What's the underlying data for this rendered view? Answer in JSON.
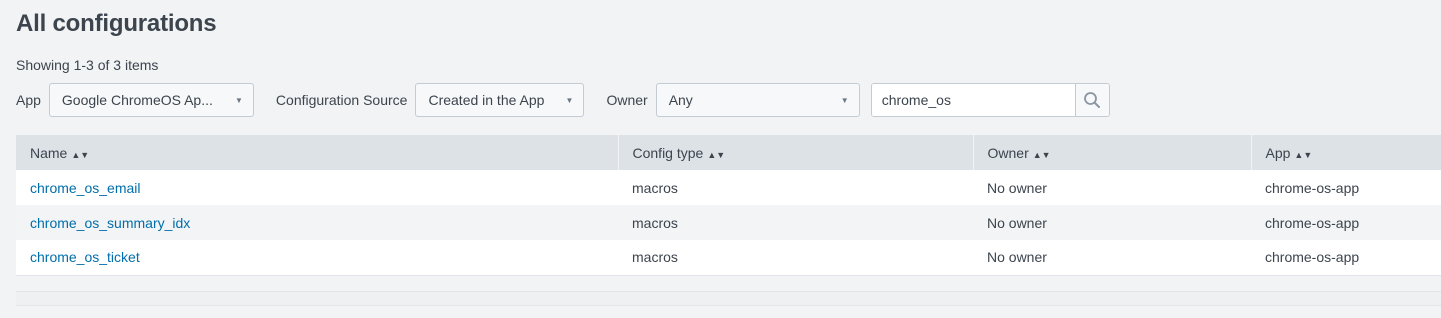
{
  "page": {
    "title": "All configurations",
    "count_text": "Showing 1-3 of 3 items"
  },
  "filters": {
    "app_label": "App",
    "app_value": "Google ChromeOS Ap...",
    "source_label": "Configuration Source",
    "source_value": "Created in the App",
    "owner_label": "Owner",
    "owner_value": "Any",
    "search_value": "chrome_os",
    "caret_icon": "caret-down-icon",
    "search_icon": "search-icon"
  },
  "table": {
    "columns": [
      "Name",
      "Config type",
      "Owner",
      "App"
    ],
    "sort_icon": "sort-icon",
    "rows": [
      {
        "name": "chrome_os_email",
        "type": "macros",
        "owner": "No owner",
        "app": "chrome-os-app"
      },
      {
        "name": "chrome_os_summary_idx",
        "type": "macros",
        "owner": "No owner",
        "app": "chrome-os-app"
      },
      {
        "name": "chrome_os_ticket",
        "type": "macros",
        "owner": "No owner",
        "app": "chrome-os-app"
      }
    ]
  },
  "colors": {
    "background": "#f2f3f5",
    "header_bg": "#dde2e7",
    "link": "#006eaa",
    "text": "#3c444d"
  }
}
